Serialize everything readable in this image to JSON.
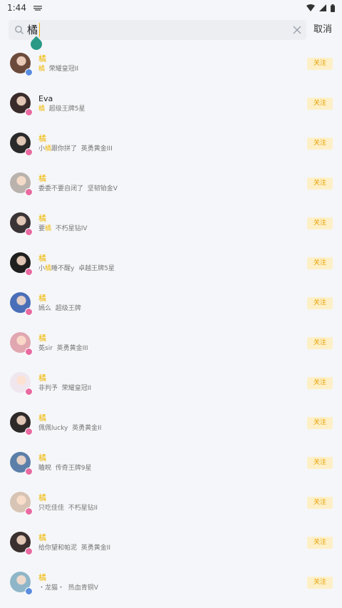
{
  "status": {
    "time": "1:44"
  },
  "search": {
    "query": "橘",
    "cancel_label": "取消"
  },
  "follow_label": "关注",
  "colors": {
    "accent": "#f0b800",
    "follow_bg": "#fdf0c8",
    "handle": "#2a9a87"
  },
  "users": [
    {
      "name": "橘",
      "sub_pre": "",
      "sub_hl": "橘",
      "sub_post": "",
      "rank": "荣耀皇冠II",
      "avatar": "#6b4a3c",
      "badge": "#5a8de0"
    },
    {
      "name": "Eva",
      "name_dark": true,
      "sub_pre": "",
      "sub_hl": "橘",
      "sub_post": "",
      "rank": "超级王牌5星",
      "avatar": "#3a2b2b",
      "badge": "#e86aa0"
    },
    {
      "name": "橘",
      "sub_pre": "小",
      "sub_hl": "橘",
      "sub_post": "跟你拼了",
      "rank": "英勇黄金III",
      "avatar": "#2a2a2a",
      "badge": "#e86aa0"
    },
    {
      "name": "橘",
      "sub_pre": "",
      "sub_hl": "",
      "sub_post": "委委不要自闭了",
      "rank": "坚韧铂金V",
      "avatar": "#b9b2ad",
      "badge": "#e86aa0"
    },
    {
      "name": "橘",
      "sub_pre": "要",
      "sub_hl": "橘",
      "sub_post": "",
      "rank": "不朽星钻IV",
      "avatar": "#3b3436",
      "badge": "#e86aa0"
    },
    {
      "name": "橘",
      "sub_pre": "小",
      "sub_hl": "橘",
      "sub_post": "睡不醒y",
      "rank": "卓越王牌5星",
      "avatar": "#1f1f1f",
      "badge": "#e86aa0"
    },
    {
      "name": "橘",
      "sub_pre": "",
      "sub_hl": "",
      "sub_post": "嫣么",
      "rank": "超级王牌",
      "avatar": "#4a6fb8",
      "badge": "#e86aa0"
    },
    {
      "name": "橘",
      "sub_pre": "",
      "sub_hl": "",
      "sub_post": "莬sir",
      "rank": "英勇黄金III",
      "avatar": "#e0a7b0",
      "badge": "#e86aa0"
    },
    {
      "name": "橘",
      "sub_pre": "",
      "sub_hl": "",
      "sub_post": "非判予",
      "rank": "荣耀皇冠II",
      "avatar": "#efe6ee",
      "badge": "#e86aa0"
    },
    {
      "name": "橘",
      "sub_pre": "",
      "sub_hl": "",
      "sub_post": "佩佩lucky",
      "rank": "英勇黄金II",
      "avatar": "#2f2a2a",
      "badge": "#e86aa0"
    },
    {
      "name": "橘",
      "sub_pre": "",
      "sub_hl": "",
      "sub_post": "瞌睨",
      "rank": "传奇王牌9星",
      "avatar": "#5b7fa8",
      "badge": "#e86aa0"
    },
    {
      "name": "橘",
      "sub_pre": "",
      "sub_hl": "",
      "sub_post": "只吃佳佳",
      "rank": "不朽星钻II",
      "avatar": "#d7c4b4",
      "badge": "#e86aa0"
    },
    {
      "name": "橘",
      "sub_pre": "",
      "sub_hl": "",
      "sub_post": "给你望和帕泥",
      "rank": "英勇黄金II",
      "avatar": "#3a3030",
      "badge": "#e86aa0"
    },
    {
      "name": "橘",
      "sub_pre": "",
      "sub_hl": "",
      "sub_post": "・龙猫・",
      "rank": "热血青铜V",
      "avatar": "#8fb6c8",
      "badge": "#5a8de0"
    }
  ]
}
